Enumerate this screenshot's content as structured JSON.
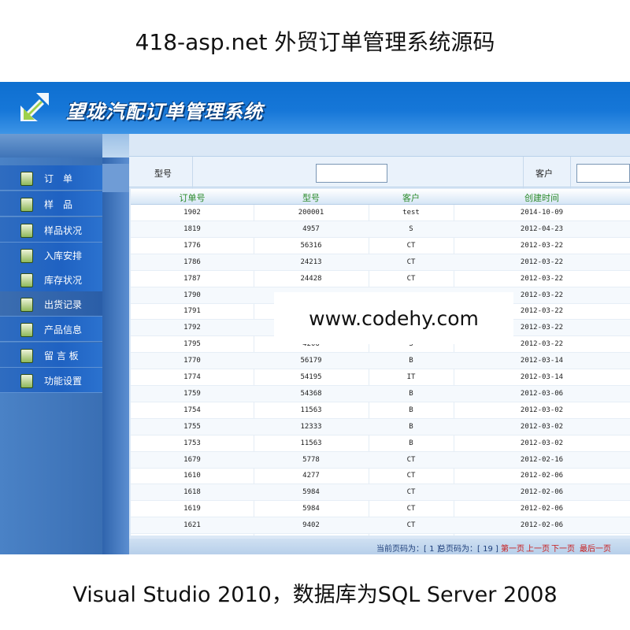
{
  "captions": {
    "top": "418-asp.net 外贸订单管理系统源码",
    "bottom": "Visual Studio 2010，数据库为SQL Server 2008",
    "watermark": "www.codehy.com"
  },
  "app": {
    "title": "望珑汽配订单管理系统",
    "logo_icon": "arrow-logo-icon"
  },
  "sidebar": {
    "items": [
      {
        "label": "订　单",
        "icon": "edit-icon"
      },
      {
        "label": "样　品",
        "icon": "document-icon"
      },
      {
        "label": "样品状况",
        "icon": "calculator-icon"
      },
      {
        "label": "入库安排",
        "icon": "notepad-icon"
      },
      {
        "label": "库存状况",
        "icon": "edit-icon"
      },
      {
        "label": "出货记录",
        "icon": "box-icon"
      },
      {
        "label": "产品信息",
        "icon": "info-icon"
      },
      {
        "label": "留 言 板",
        "icon": "board-icon"
      },
      {
        "label": "功能设置",
        "icon": "settings-icon"
      }
    ]
  },
  "search": {
    "model_label": "型号",
    "customer_label": "客户",
    "model_value": "",
    "customer_value": ""
  },
  "table": {
    "columns": [
      "订单号",
      "型号",
      "客户",
      "创建时间"
    ],
    "rows": [
      [
        "1902",
        "200001",
        "test",
        "2014-10-09"
      ],
      [
        "1819",
        "4957",
        "S",
        "2012-04-23"
      ],
      [
        "1776",
        "56316",
        "CT",
        "2012-03-22"
      ],
      [
        "1786",
        "24213",
        "CT",
        "2012-03-22"
      ],
      [
        "1787",
        "24428",
        "CT",
        "2012-03-22"
      ],
      [
        "1790",
        "",
        "",
        "2012-03-22"
      ],
      [
        "1791",
        "",
        "",
        "2012-03-22"
      ],
      [
        "1792",
        "",
        "",
        "2012-03-22"
      ],
      [
        "1795",
        "4206",
        "S",
        "2012-03-22"
      ],
      [
        "1770",
        "56179",
        "B",
        "2012-03-14"
      ],
      [
        "1774",
        "54195",
        "IT",
        "2012-03-14"
      ],
      [
        "1759",
        "54368",
        "B",
        "2012-03-06"
      ],
      [
        "1754",
        "11563",
        "B",
        "2012-03-02"
      ],
      [
        "1755",
        "12333",
        "B",
        "2012-03-02"
      ],
      [
        "1753",
        "11563",
        "B",
        "2012-03-02"
      ],
      [
        "1679",
        "5778",
        "CT",
        "2012-02-16"
      ],
      [
        "1610",
        "4277",
        "CT",
        "2012-02-06"
      ],
      [
        "1618",
        "5984",
        "CT",
        "2012-02-06"
      ],
      [
        "1619",
        "5984",
        "CT",
        "2012-02-06"
      ],
      [
        "1621",
        "9402",
        "CT",
        "2012-02-06"
      ]
    ]
  },
  "pager": {
    "current_label": "当前页码为：[ 1 ]",
    "total_label": "总页码为：[ 19 ]",
    "first": "第一页",
    "prev": "上一页",
    "next": "下一页",
    "last": "最后一页"
  },
  "colors": {
    "banner": "#1677d8",
    "header_text": "#2b8a2b",
    "pager_link": "#c81a1a"
  }
}
